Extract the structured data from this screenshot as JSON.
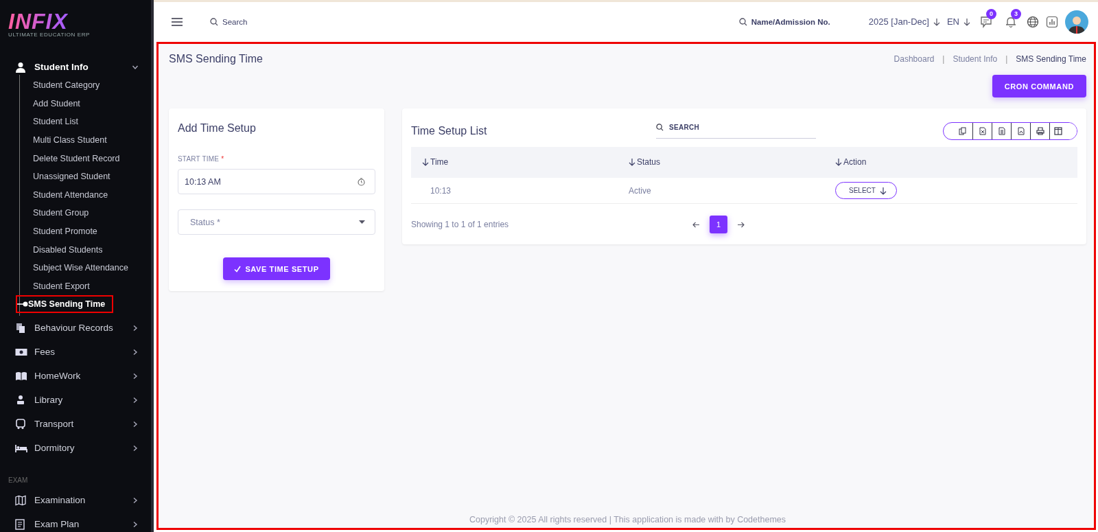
{
  "logo": {
    "title": "INFIX",
    "subtitle": "ULTIMATE EDUCATION ERP"
  },
  "sidebar": {
    "items": [
      {
        "label": "Student Info",
        "expanded": true,
        "children": [
          {
            "label": "Student Category",
            "selected": false,
            "highlighted": false
          },
          {
            "label": "Add Student",
            "selected": false,
            "highlighted": false
          },
          {
            "label": "Student List",
            "selected": false,
            "highlighted": false
          },
          {
            "label": "Multi Class Student",
            "selected": false,
            "highlighted": false
          },
          {
            "label": "Delete Student Record",
            "selected": false,
            "highlighted": false
          },
          {
            "label": "Unassigned Student",
            "selected": false,
            "highlighted": false
          },
          {
            "label": "Student Attendance",
            "selected": false,
            "highlighted": false
          },
          {
            "label": "Student Group",
            "selected": false,
            "highlighted": false
          },
          {
            "label": "Student Promote",
            "selected": false,
            "highlighted": false
          },
          {
            "label": "Disabled Students",
            "selected": false,
            "highlighted": false
          },
          {
            "label": "Subject Wise Attendance",
            "selected": false,
            "highlighted": false
          },
          {
            "label": "Student Export",
            "selected": false,
            "highlighted": false
          },
          {
            "label": "SMS Sending Time",
            "selected": true,
            "highlighted": true
          }
        ]
      },
      {
        "label": "Behaviour Records",
        "expanded": false
      },
      {
        "label": "Fees",
        "expanded": false
      },
      {
        "label": "HomeWork",
        "expanded": false
      },
      {
        "label": "Library",
        "expanded": false
      },
      {
        "label": "Transport",
        "expanded": false
      },
      {
        "label": "Dormitory",
        "expanded": false
      }
    ],
    "sections": [
      {
        "heading": "EXAM",
        "items": [
          {
            "label": "Examination",
            "expanded": false
          },
          {
            "label": "Exam Plan",
            "expanded": false
          }
        ]
      }
    ]
  },
  "topbar": {
    "search_placeholder": "Search",
    "student_search_placeholder": "Name/Admission No.",
    "session": "2025 [Jan-Dec]",
    "language": "EN",
    "messages_count": "0",
    "notifications_count": "3"
  },
  "page": {
    "title": "SMS Sending Time",
    "highlighted": true,
    "breadcrumb_separator": "|",
    "breadcrumb": [
      {
        "label": "Dashboard",
        "selected": false
      },
      {
        "label": "Student Info",
        "selected": false
      },
      {
        "label": "SMS Sending Time",
        "selected": true
      }
    ],
    "cron_button": "CRON COMMAND"
  },
  "form": {
    "title": "Add Time Setup",
    "start_time_label": "START TIME",
    "required_mark": "*",
    "start_time_value": "10:13 AM",
    "status_placeholder": "Status *",
    "save_button": "SAVE TIME SETUP"
  },
  "list": {
    "title": "Time Setup List",
    "search_placeholder": "SEARCH",
    "export_buttons": [
      {
        "kind": "copy"
      },
      {
        "kind": "excel"
      },
      {
        "kind": "csv"
      },
      {
        "kind": "pdf"
      },
      {
        "kind": "print"
      },
      {
        "kind": "columns"
      }
    ],
    "columns": [
      "Time",
      "Status",
      "Action"
    ],
    "rows": [
      {
        "time": "10:13",
        "status": "Active",
        "action": "SELECT"
      }
    ],
    "info": "Showing 1 to 1 of 1 entries",
    "pages": [
      {
        "label": "1",
        "selected": true
      }
    ]
  },
  "footer": "Copyright © 2025 All rights reserved | This application is made with by Codethemes"
}
